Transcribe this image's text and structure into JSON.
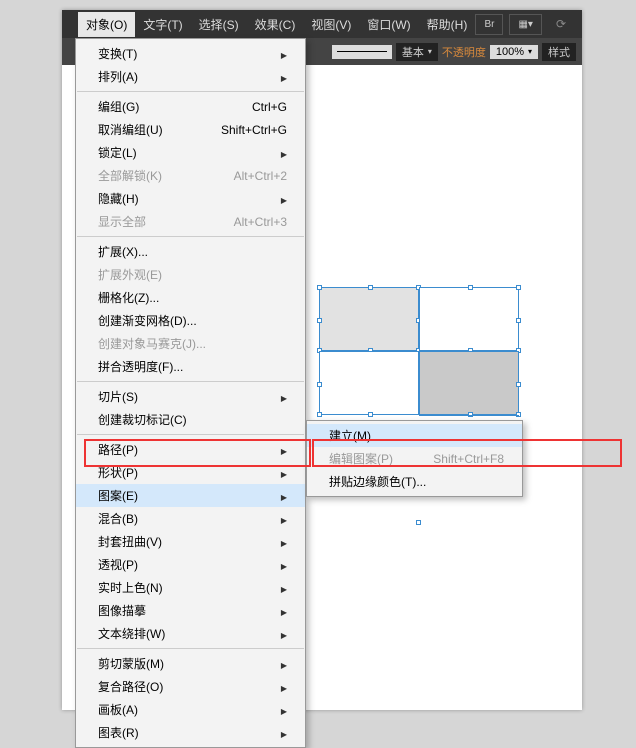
{
  "menubar": {
    "items": [
      {
        "label": "对象(O)",
        "active": true
      },
      {
        "label": "文字(T)"
      },
      {
        "label": "选择(S)"
      },
      {
        "label": "效果(C)"
      },
      {
        "label": "视图(V)"
      },
      {
        "label": "窗口(W)"
      },
      {
        "label": "帮助(H)"
      }
    ],
    "br_badge": "Br"
  },
  "toolbar": {
    "basic_label": "基本",
    "opacity_label": "不透明度",
    "opacity_value": "100%",
    "style_label": "样式"
  },
  "menu": {
    "items": [
      {
        "label": "变换(T)",
        "sub": true
      },
      {
        "label": "排列(A)",
        "sub": true
      },
      {
        "sep": true
      },
      {
        "label": "编组(G)",
        "shortcut": "Ctrl+G"
      },
      {
        "label": "取消编组(U)",
        "shortcut": "Shift+Ctrl+G"
      },
      {
        "label": "锁定(L)",
        "sub": true
      },
      {
        "label": "全部解锁(K)",
        "shortcut": "Alt+Ctrl+2",
        "disabled": true
      },
      {
        "label": "隐藏(H)",
        "sub": true
      },
      {
        "label": "显示全部",
        "shortcut": "Alt+Ctrl+3",
        "disabled": true
      },
      {
        "sep": true
      },
      {
        "label": "扩展(X)..."
      },
      {
        "label": "扩展外观(E)",
        "disabled": true
      },
      {
        "label": "栅格化(Z)..."
      },
      {
        "label": "创建渐变网格(D)..."
      },
      {
        "label": "创建对象马赛克(J)...",
        "disabled": true
      },
      {
        "label": "拼合透明度(F)..."
      },
      {
        "sep": true
      },
      {
        "label": "切片(S)",
        "sub": true
      },
      {
        "label": "创建裁切标记(C)"
      },
      {
        "sep": true
      },
      {
        "label": "路径(P)",
        "sub": true
      },
      {
        "label": "形状(P)",
        "sub": true
      },
      {
        "label": "图案(E)",
        "sub": true,
        "hl": true
      },
      {
        "label": "混合(B)",
        "sub": true
      },
      {
        "label": "封套扭曲(V)",
        "sub": true
      },
      {
        "label": "透视(P)",
        "sub": true
      },
      {
        "label": "实时上色(N)",
        "sub": true
      },
      {
        "label": "图像描摹",
        "sub": true
      },
      {
        "label": "文本绕排(W)",
        "sub": true
      },
      {
        "sep": true
      },
      {
        "label": "剪切蒙版(M)",
        "sub": true
      },
      {
        "label": "复合路径(O)",
        "sub": true
      },
      {
        "label": "画板(A)",
        "sub": true
      },
      {
        "label": "图表(R)",
        "sub": true
      }
    ]
  },
  "submenu": {
    "items": [
      {
        "label": "建立(M)",
        "hl": true
      },
      {
        "label": "编辑图案(P)",
        "shortcut": "Shift+Ctrl+F8",
        "disabled": true
      },
      {
        "label": "拼贴边缘颜色(T)..."
      }
    ]
  }
}
